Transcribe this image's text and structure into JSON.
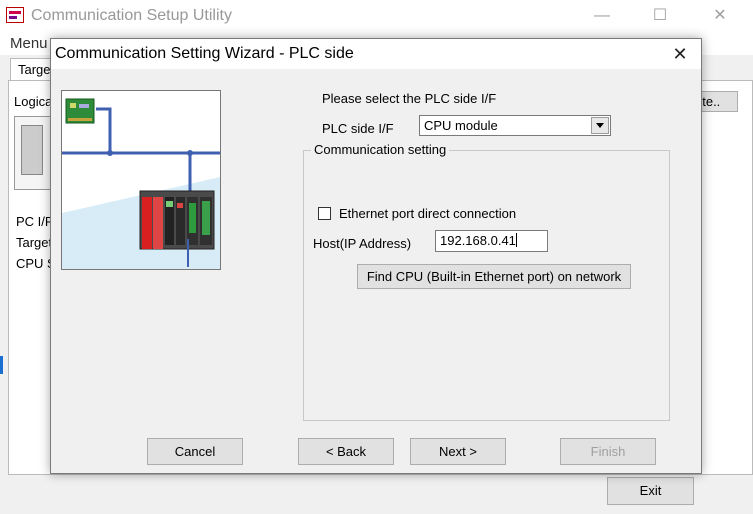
{
  "main_window": {
    "title": "Communication Setup Utility",
    "minimize_glyph": "—",
    "maximize_glyph": "☐",
    "close_glyph": "✕",
    "menu_label": "Menu",
    "tab_label": "Targe",
    "logical_label": "Logica",
    "partial_button_label": "ete..",
    "left_labels": [
      "PC I/F",
      "Target",
      "CPU S"
    ],
    "exit_label": "Exit"
  },
  "dialog": {
    "title": "Communication Setting Wizard - PLC side",
    "close_glyph": "✕",
    "prompt": "Please select the PLC side I/F",
    "plc_if_label": "PLC side I/F",
    "plc_if_value": "CPU module",
    "group_title": "Communication setting",
    "ethernet_direct_label": "Ethernet port direct connection",
    "ethernet_direct_checked": false,
    "host_label": "Host(IP Address)",
    "host_value": "192.168.0.41",
    "find_button_label": "Find CPU (Built-in Ethernet port) on network",
    "cancel_label": "Cancel",
    "back_label": "< Back",
    "next_label": "Next >",
    "finish_label": "Finish"
  },
  "colors": {
    "dialog_bg": "#f0f0f0",
    "button_bg": "#e1e1e1",
    "disabled_text": "#a0a0a0",
    "illustration_bus": "#3f5fb0",
    "illustration_floor": "#d8ecf8"
  }
}
